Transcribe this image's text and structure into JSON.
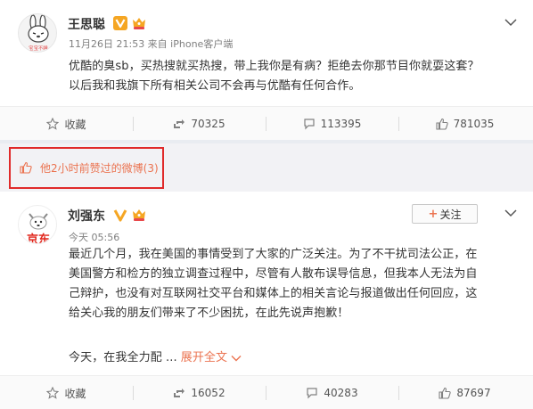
{
  "post1": {
    "author": "王思聪",
    "avatar_caption": "宝宝不睡",
    "meta": "11月26日 21:53 来自 iPhone客户端",
    "text_lines": [
      "优酷的臭sb，买热搜就买热搜，带上我你是有病？拒绝去你那节目你就耍这套？",
      "以后我和我旗下所有相关公司不会再与优酷有任何合作。"
    ],
    "actions": {
      "collect": "收藏",
      "repost": "70325",
      "comment": "113395",
      "like": "781035"
    }
  },
  "liked_strip": {
    "text": "他2小时前赞过的微博(3)"
  },
  "post2": {
    "author": "刘强东",
    "avatar_caption": "京东",
    "meta": "今天 05:56",
    "follow_label": "关注",
    "text_lines": [
      "最近几个月，我在美国的事情受到了大家的广泛关注。为了不干扰司法公正，在",
      "美国警方和检方的独立调查过程中，尽管有人散布误导信息，但我本人无法为自",
      "己辩护，也没有对互联网社交平台和媒体上的相关言论与报道做出任何回应，这",
      "给关心我的朋友们带来了不少困扰，在此先说声抱歉！"
    ],
    "preview_text": "今天，在我全力配 ...",
    "expand_label": "展开全文",
    "actions": {
      "collect": "收藏",
      "repost": "16052",
      "comment": "40283",
      "like": "87697"
    }
  },
  "colors": {
    "accent_orange": "#eb7350",
    "highlight_red": "#e02a2a",
    "verified_gold": "#f5a623"
  }
}
